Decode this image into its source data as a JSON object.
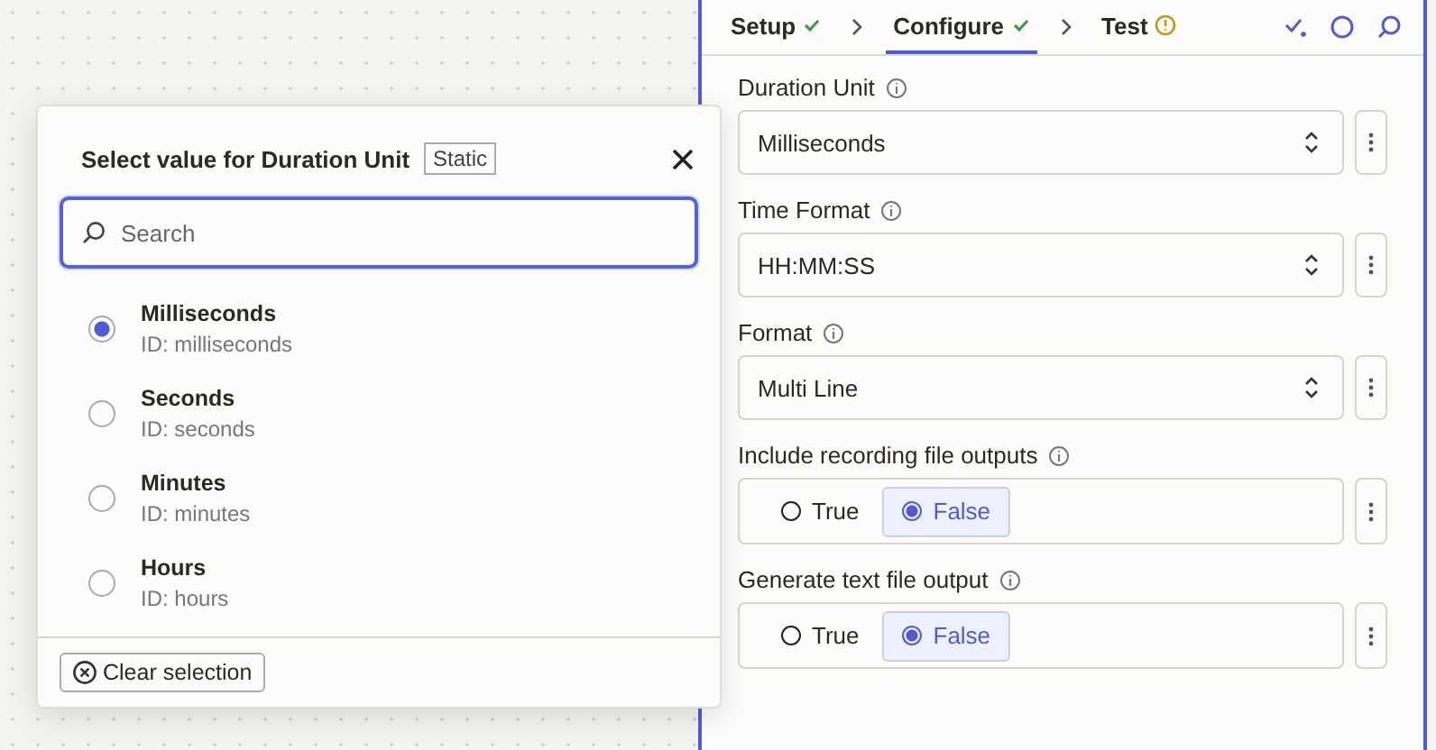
{
  "panel": {
    "steps": [
      {
        "label": "Setup",
        "kind": "done",
        "selected": false
      },
      {
        "label": "Configure",
        "kind": "done",
        "selected": true
      },
      {
        "label": "Test",
        "kind": "warning",
        "selected": false
      }
    ],
    "fields": [
      {
        "kind": "select",
        "label": "Duration Unit",
        "value": "Milliseconds"
      },
      {
        "kind": "select",
        "label": "Time Format",
        "value": "HH:MM:SS"
      },
      {
        "kind": "select",
        "label": "Format",
        "value": "Multi Line"
      },
      {
        "kind": "boolean",
        "label": "Include recording file outputs",
        "options": [
          {
            "label": "True",
            "selected": false
          },
          {
            "label": "False",
            "selected": true
          }
        ]
      },
      {
        "kind": "boolean",
        "label": "Generate text file output",
        "options": [
          {
            "label": "True",
            "selected": false
          },
          {
            "label": "False",
            "selected": true
          }
        ]
      }
    ]
  },
  "popup": {
    "title": "Select value for Duration Unit",
    "badge": "Static",
    "search": {
      "placeholder": "Search"
    },
    "options": [
      {
        "label": "Milliseconds",
        "id": "ID: milliseconds",
        "selected": true
      },
      {
        "label": "Seconds",
        "id": "ID: seconds",
        "selected": false
      },
      {
        "label": "Minutes",
        "id": "ID: minutes",
        "selected": false
      },
      {
        "label": "Hours",
        "id": "ID: hours",
        "selected": false
      }
    ],
    "clear_button": "Clear selection"
  }
}
